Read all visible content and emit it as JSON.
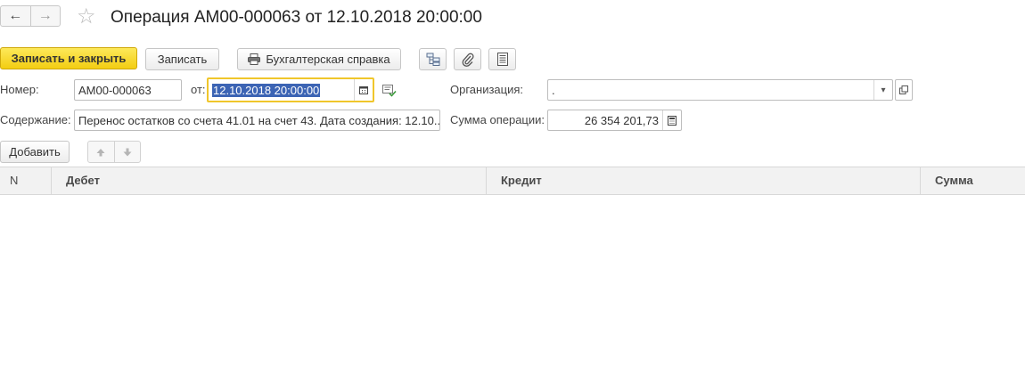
{
  "header": {
    "back_icon": "arrow-left-icon",
    "forward_icon": "arrow-right-icon",
    "favorite_icon": "star-icon",
    "title": "Операция АМ00-000063 от 12.10.2018 20:00:00"
  },
  "toolbar": {
    "save_close_label": "Записать и закрыть",
    "save_label": "Записать",
    "accounting_report_label": "Бухгалтерская справка",
    "accounting_report_icon": "printer-icon",
    "structure_icon": "hierarchy-icon",
    "attach_icon": "paperclip-icon",
    "list_icon": "document-list-icon"
  },
  "form": {
    "number_label": "Номер:",
    "number_value": "АМ00-000063",
    "date_label": "от:",
    "date_value": "12.10.2018 20:00:00",
    "org_label": "Организация:",
    "org_value": ".",
    "content_label": "Содержание:",
    "content_value": "Перенос остатков со счета 41.01 на счет 43. Дата создания: 12.10..",
    "sum_label": "Сумма операции:",
    "sum_value": "26 354 201,73"
  },
  "table_toolbar": {
    "add_label": "Добавить",
    "move_up_icon": "arrow-up-icon",
    "move_down_icon": "arrow-down-icon"
  },
  "table": {
    "columns": [
      "N",
      "Дебет",
      "Кредит",
      "Сумма"
    ],
    "rows": []
  },
  "colors": {
    "primary_button": "#f5d21c",
    "focus_border": "#f0c62b",
    "selection": "#3c64b4"
  }
}
